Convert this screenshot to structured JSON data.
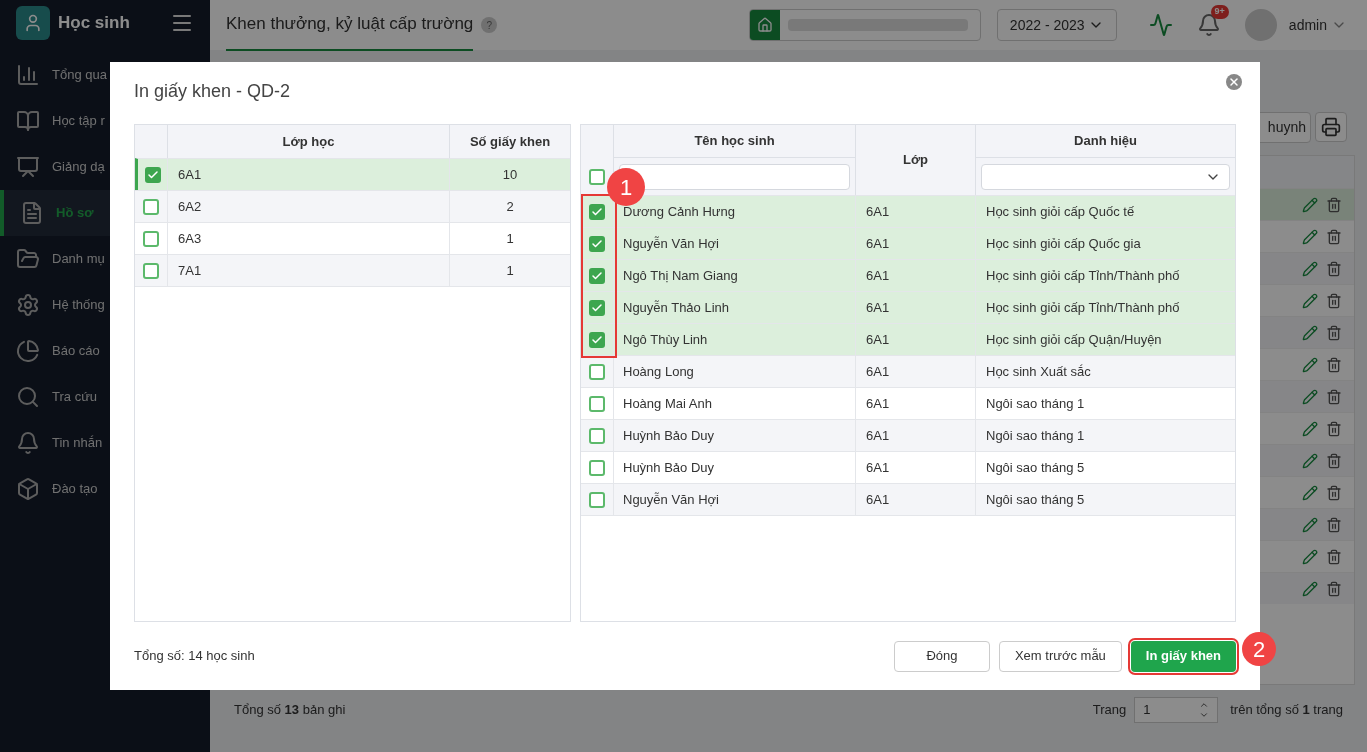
{
  "app": {
    "title": "Học sinh"
  },
  "sidebar": {
    "items": [
      {
        "label": "Tổng qua",
        "selected": false
      },
      {
        "label": "Học tập r",
        "selected": false
      },
      {
        "label": "Giảng dạ",
        "selected": false
      },
      {
        "label": "Hồ sơ",
        "selected": true
      },
      {
        "label": "Danh mụ",
        "selected": false
      },
      {
        "label": "Hệ thống",
        "selected": false
      },
      {
        "label": "Báo cáo",
        "selected": false
      },
      {
        "label": "Tra cứu",
        "selected": false
      },
      {
        "label": "Tin nhắn",
        "selected": false
      },
      {
        "label": "Đào tạo",
        "selected": false
      }
    ]
  },
  "header": {
    "page_title": "Khen thưởng, kỷ luật cấp trường",
    "help": "?",
    "school_year": "2022 - 2023",
    "notification_badge": "9+",
    "user": "admin"
  },
  "toolbar": {
    "button": "huynh"
  },
  "background_table": {
    "rows": [
      {
        "selected": true
      },
      {
        "selected": false
      },
      {
        "selected": false
      },
      {
        "selected": false
      },
      {
        "selected": false
      },
      {
        "selected": false
      },
      {
        "selected": false
      },
      {
        "selected": false
      },
      {
        "selected": false
      },
      {
        "selected": false
      },
      {
        "selected": false
      },
      {
        "selected": false
      },
      {
        "selected": false
      }
    ]
  },
  "footer": {
    "total": "Tổng số **13** bản ghi",
    "page_label": "Trang",
    "page_value": "1",
    "page_total": "trên tổng số **1** trang"
  },
  "dialog": {
    "title": "In giấy khen - QD-2",
    "class_table": {
      "columns": [
        "Lớp học",
        "Số giấy khen"
      ],
      "rows": [
        {
          "class": "6A1",
          "count": "10",
          "checked": true,
          "selected": true
        },
        {
          "class": "6A2",
          "count": "2",
          "checked": false,
          "selected": false
        },
        {
          "class": "6A3",
          "count": "1",
          "checked": false,
          "selected": false
        },
        {
          "class": "7A1",
          "count": "1",
          "checked": false,
          "selected": false
        }
      ]
    },
    "student_table": {
      "columns": [
        "Tên học sinh",
        "Lớp",
        "Danh hiệu"
      ],
      "select_all_checked": false,
      "rows": [
        {
          "name": "Dương Cảnh Hưng",
          "class": "6A1",
          "title": "Học sinh giỏi cấp Quốc tế",
          "checked": true
        },
        {
          "name": "Nguyễn Văn Hợi",
          "class": "6A1",
          "title": "Học sinh giỏi cấp Quốc gia",
          "checked": true
        },
        {
          "name": "Ngô Thị Nam Giang",
          "class": "6A1",
          "title": "Học sinh giỏi cấp Tỉnh/Thành phố",
          "checked": true
        },
        {
          "name": "Nguyễn Thảo Linh",
          "class": "6A1",
          "title": "Học sinh giỏi cấp Tỉnh/Thành phố",
          "checked": true
        },
        {
          "name": "Ngô Thùy Linh",
          "class": "6A1",
          "title": "Học sinh giỏi cấp Quận/Huyện",
          "checked": true
        },
        {
          "name": "Hoàng Long",
          "class": "6A1",
          "title": "Học sinh Xuất sắc",
          "checked": false
        },
        {
          "name": "Hoàng Mai Anh",
          "class": "6A1",
          "title": "Ngôi sao tháng 1",
          "checked": false
        },
        {
          "name": "Huỳnh Bảo Duy",
          "class": "6A1",
          "title": "Ngôi sao tháng 1",
          "checked": false
        },
        {
          "name": "Huỳnh Bảo Duy",
          "class": "6A1",
          "title": "Ngôi sao tháng 5",
          "checked": false
        },
        {
          "name": "Nguyễn Văn Hợi",
          "class": "6A1",
          "title": "Ngôi sao tháng 5",
          "checked": false
        }
      ]
    },
    "total": "Tổng số: 14 học sinh",
    "buttons": [
      {
        "label": "Đóng",
        "kind": "secondary",
        "highlighted": false
      },
      {
        "label": "Xem trước mẫu",
        "kind": "secondary",
        "highlighted": false
      },
      {
        "label": "In giấy khen",
        "kind": "primary",
        "highlighted": true
      }
    ]
  },
  "annotations": [
    {
      "label": "1"
    },
    {
      "label": "2"
    }
  ]
}
